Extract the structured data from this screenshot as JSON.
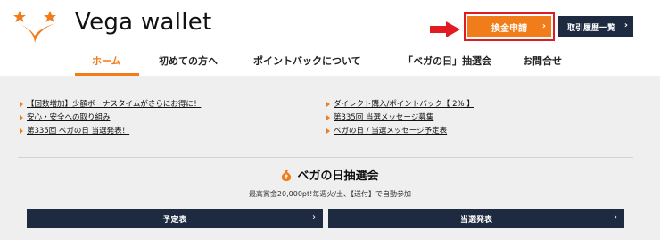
{
  "brand": {
    "name": "Vega wallet"
  },
  "header": {
    "withdraw_label": "換金申請",
    "history_label": "取引履歴一覧",
    "chevron": "›"
  },
  "nav": {
    "items": [
      {
        "label": "ホーム",
        "active": true
      },
      {
        "label": "初めての方へ"
      },
      {
        "label": "ポイントバックについて"
      },
      {
        "label": "「ベガの日」抽選会"
      },
      {
        "label": "お問合せ"
      }
    ]
  },
  "news": {
    "left": [
      "【回数増加】少額ボーナスタイムがさらにお得に！",
      "安心・安全への取り組み",
      "第335回 ベガの日 当選発表！"
    ],
    "right": [
      "ダイレクト購入/ポイントバック【 2% 】",
      "第335回 当選メッセージ募集",
      "ベガの日 / 当選メッセージ予定表"
    ]
  },
  "lottery": {
    "title": "ベガの日抽選会",
    "subtitle": "最高賞金20,000pt!毎週火/土、【送付】で自動参加",
    "schedule_label": "予定表",
    "results_label": "当選発表"
  },
  "colors": {
    "accent": "#f07c1a",
    "navy": "#1d2a3f",
    "highlight_red": "#e11b22",
    "background_grey": "#efefef"
  },
  "icons": [
    "vega-logo-icon",
    "red-arrow-icon",
    "chevron-right-icon",
    "money-bag-icon",
    "bullet-triangle-icon"
  ]
}
